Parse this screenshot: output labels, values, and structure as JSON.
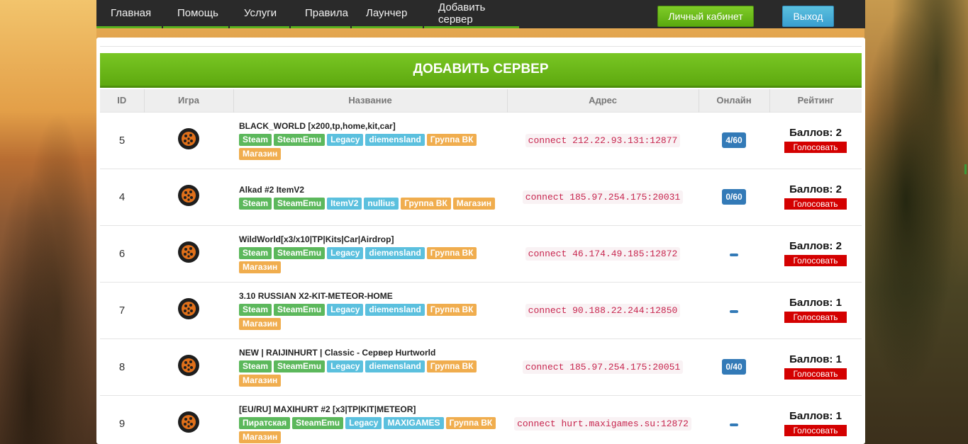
{
  "nav": {
    "items": [
      "Главная",
      "Помощь",
      "Услуги",
      "Правила",
      "Лаунчер",
      "Добавить сервер"
    ],
    "cabinet_label": "Личный кабинет",
    "logout_label": "Выход"
  },
  "banner": {
    "title": "ДОБАВИТЬ СЕРВЕР"
  },
  "table": {
    "headers": [
      "ID",
      "Игра",
      "Название",
      "Адрес",
      "Онлайн",
      "Рейтинг"
    ],
    "vote_label": "Голосовать",
    "rows": [
      {
        "id": "5",
        "name": "BLACK_WORLD [x200,tp,home,kit,car]",
        "tags": [
          [
            "Steam",
            "green"
          ],
          [
            "SteamEmu",
            "green"
          ],
          [
            "Legacy",
            "blue"
          ],
          [
            "diemensland",
            "blue"
          ],
          [
            "Группа ВК",
            "orange"
          ],
          [
            "Магазин",
            "orange"
          ]
        ],
        "address": "connect 212.22.93.131:12877",
        "online": "4/60",
        "score": "Баллов: 2"
      },
      {
        "id": "4",
        "name": "Alkad #2 ItemV2",
        "tags": [
          [
            "Steam",
            "green"
          ],
          [
            "SteamEmu",
            "green"
          ],
          [
            "ItemV2",
            "blue"
          ],
          [
            "nullius",
            "blue"
          ],
          [
            "Группа ВК",
            "orange"
          ],
          [
            "Магазин",
            "orange"
          ]
        ],
        "address": "connect 185.97.254.175:20031",
        "online": "0/60",
        "score": "Баллов: 2"
      },
      {
        "id": "6",
        "name": "WildWorld[x3/x10|TP|Kits|Car|Airdrop]",
        "tags": [
          [
            "Steam",
            "green"
          ],
          [
            "SteamEmu",
            "green"
          ],
          [
            "Legacy",
            "blue"
          ],
          [
            "diemensland",
            "blue"
          ],
          [
            "Группа ВК",
            "orange"
          ],
          [
            "Магазин",
            "orange"
          ]
        ],
        "address": "connect 46.174.49.185:12872",
        "online": "",
        "score": "Баллов: 2"
      },
      {
        "id": "7",
        "name": "3.10 RUSSIAN X2-KIT-METEOR-HOME",
        "tags": [
          [
            "Steam",
            "green"
          ],
          [
            "SteamEmu",
            "green"
          ],
          [
            "Legacy",
            "blue"
          ],
          [
            "diemensland",
            "blue"
          ],
          [
            "Группа ВК",
            "orange"
          ],
          [
            "Магазин",
            "orange"
          ]
        ],
        "address": "connect 90.188.22.244:12850",
        "online": "",
        "score": "Баллов: 1"
      },
      {
        "id": "8",
        "name": "NEW | RAIJINHURT | Classic - Сервер Hurtworld",
        "tags": [
          [
            "Steam",
            "green"
          ],
          [
            "SteamEmu",
            "green"
          ],
          [
            "Legacy",
            "blue"
          ],
          [
            "diemensland",
            "blue"
          ],
          [
            "Группа ВК",
            "orange"
          ],
          [
            "Магазин",
            "orange"
          ]
        ],
        "address": "connect 185.97.254.175:20051",
        "online": "0/40",
        "score": "Баллов: 1"
      },
      {
        "id": "9",
        "name": "[EU/RU] MAXIHURT #2 [x3|TP|KIT|METEOR]",
        "tags": [
          [
            "Пиратская",
            "green"
          ],
          [
            "SteamEmu",
            "green"
          ],
          [
            "Legacy",
            "blue"
          ],
          [
            "MAXIGAMES",
            "blue"
          ],
          [
            "Группа ВК",
            "orange"
          ],
          [
            "Магазин",
            "orange"
          ]
        ],
        "address": "connect hurt.maxigames.su:12872",
        "online": "",
        "score": "Баллов: 1"
      }
    ]
  },
  "colors": {
    "accent_green": "#5ea90f",
    "nav_bg": "#2a2a2a",
    "vote_red": "#d40000",
    "online_blue": "#337ab7"
  },
  "icons": {
    "game": "hurtworld-game-icon"
  }
}
